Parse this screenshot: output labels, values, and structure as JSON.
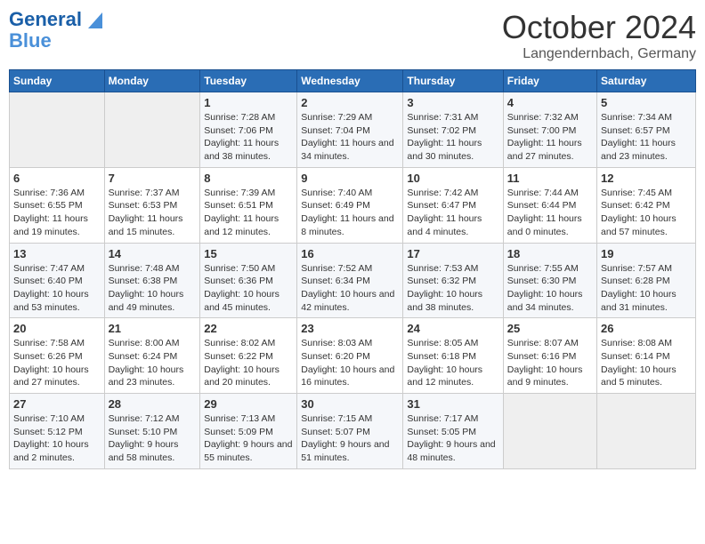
{
  "header": {
    "logo_line1": "General",
    "logo_line2": "Blue",
    "month_title": "October 2024",
    "location": "Langendernbach, Germany"
  },
  "days_of_week": [
    "Sunday",
    "Monday",
    "Tuesday",
    "Wednesday",
    "Thursday",
    "Friday",
    "Saturday"
  ],
  "weeks": [
    [
      {
        "day": "",
        "content": ""
      },
      {
        "day": "",
        "content": ""
      },
      {
        "day": "1",
        "content": "Sunrise: 7:28 AM\nSunset: 7:06 PM\nDaylight: 11 hours and 38 minutes."
      },
      {
        "day": "2",
        "content": "Sunrise: 7:29 AM\nSunset: 7:04 PM\nDaylight: 11 hours and 34 minutes."
      },
      {
        "day": "3",
        "content": "Sunrise: 7:31 AM\nSunset: 7:02 PM\nDaylight: 11 hours and 30 minutes."
      },
      {
        "day": "4",
        "content": "Sunrise: 7:32 AM\nSunset: 7:00 PM\nDaylight: 11 hours and 27 minutes."
      },
      {
        "day": "5",
        "content": "Sunrise: 7:34 AM\nSunset: 6:57 PM\nDaylight: 11 hours and 23 minutes."
      }
    ],
    [
      {
        "day": "6",
        "content": "Sunrise: 7:36 AM\nSunset: 6:55 PM\nDaylight: 11 hours and 19 minutes."
      },
      {
        "day": "7",
        "content": "Sunrise: 7:37 AM\nSunset: 6:53 PM\nDaylight: 11 hours and 15 minutes."
      },
      {
        "day": "8",
        "content": "Sunrise: 7:39 AM\nSunset: 6:51 PM\nDaylight: 11 hours and 12 minutes."
      },
      {
        "day": "9",
        "content": "Sunrise: 7:40 AM\nSunset: 6:49 PM\nDaylight: 11 hours and 8 minutes."
      },
      {
        "day": "10",
        "content": "Sunrise: 7:42 AM\nSunset: 6:47 PM\nDaylight: 11 hours and 4 minutes."
      },
      {
        "day": "11",
        "content": "Sunrise: 7:44 AM\nSunset: 6:44 PM\nDaylight: 11 hours and 0 minutes."
      },
      {
        "day": "12",
        "content": "Sunrise: 7:45 AM\nSunset: 6:42 PM\nDaylight: 10 hours and 57 minutes."
      }
    ],
    [
      {
        "day": "13",
        "content": "Sunrise: 7:47 AM\nSunset: 6:40 PM\nDaylight: 10 hours and 53 minutes."
      },
      {
        "day": "14",
        "content": "Sunrise: 7:48 AM\nSunset: 6:38 PM\nDaylight: 10 hours and 49 minutes."
      },
      {
        "day": "15",
        "content": "Sunrise: 7:50 AM\nSunset: 6:36 PM\nDaylight: 10 hours and 45 minutes."
      },
      {
        "day": "16",
        "content": "Sunrise: 7:52 AM\nSunset: 6:34 PM\nDaylight: 10 hours and 42 minutes."
      },
      {
        "day": "17",
        "content": "Sunrise: 7:53 AM\nSunset: 6:32 PM\nDaylight: 10 hours and 38 minutes."
      },
      {
        "day": "18",
        "content": "Sunrise: 7:55 AM\nSunset: 6:30 PM\nDaylight: 10 hours and 34 minutes."
      },
      {
        "day": "19",
        "content": "Sunrise: 7:57 AM\nSunset: 6:28 PM\nDaylight: 10 hours and 31 minutes."
      }
    ],
    [
      {
        "day": "20",
        "content": "Sunrise: 7:58 AM\nSunset: 6:26 PM\nDaylight: 10 hours and 27 minutes."
      },
      {
        "day": "21",
        "content": "Sunrise: 8:00 AM\nSunset: 6:24 PM\nDaylight: 10 hours and 23 minutes."
      },
      {
        "day": "22",
        "content": "Sunrise: 8:02 AM\nSunset: 6:22 PM\nDaylight: 10 hours and 20 minutes."
      },
      {
        "day": "23",
        "content": "Sunrise: 8:03 AM\nSunset: 6:20 PM\nDaylight: 10 hours and 16 minutes."
      },
      {
        "day": "24",
        "content": "Sunrise: 8:05 AM\nSunset: 6:18 PM\nDaylight: 10 hours and 12 minutes."
      },
      {
        "day": "25",
        "content": "Sunrise: 8:07 AM\nSunset: 6:16 PM\nDaylight: 10 hours and 9 minutes."
      },
      {
        "day": "26",
        "content": "Sunrise: 8:08 AM\nSunset: 6:14 PM\nDaylight: 10 hours and 5 minutes."
      }
    ],
    [
      {
        "day": "27",
        "content": "Sunrise: 7:10 AM\nSunset: 5:12 PM\nDaylight: 10 hours and 2 minutes."
      },
      {
        "day": "28",
        "content": "Sunrise: 7:12 AM\nSunset: 5:10 PM\nDaylight: 9 hours and 58 minutes."
      },
      {
        "day": "29",
        "content": "Sunrise: 7:13 AM\nSunset: 5:09 PM\nDaylight: 9 hours and 55 minutes."
      },
      {
        "day": "30",
        "content": "Sunrise: 7:15 AM\nSunset: 5:07 PM\nDaylight: 9 hours and 51 minutes."
      },
      {
        "day": "31",
        "content": "Sunrise: 7:17 AM\nSunset: 5:05 PM\nDaylight: 9 hours and 48 minutes."
      },
      {
        "day": "",
        "content": ""
      },
      {
        "day": "",
        "content": ""
      }
    ]
  ]
}
